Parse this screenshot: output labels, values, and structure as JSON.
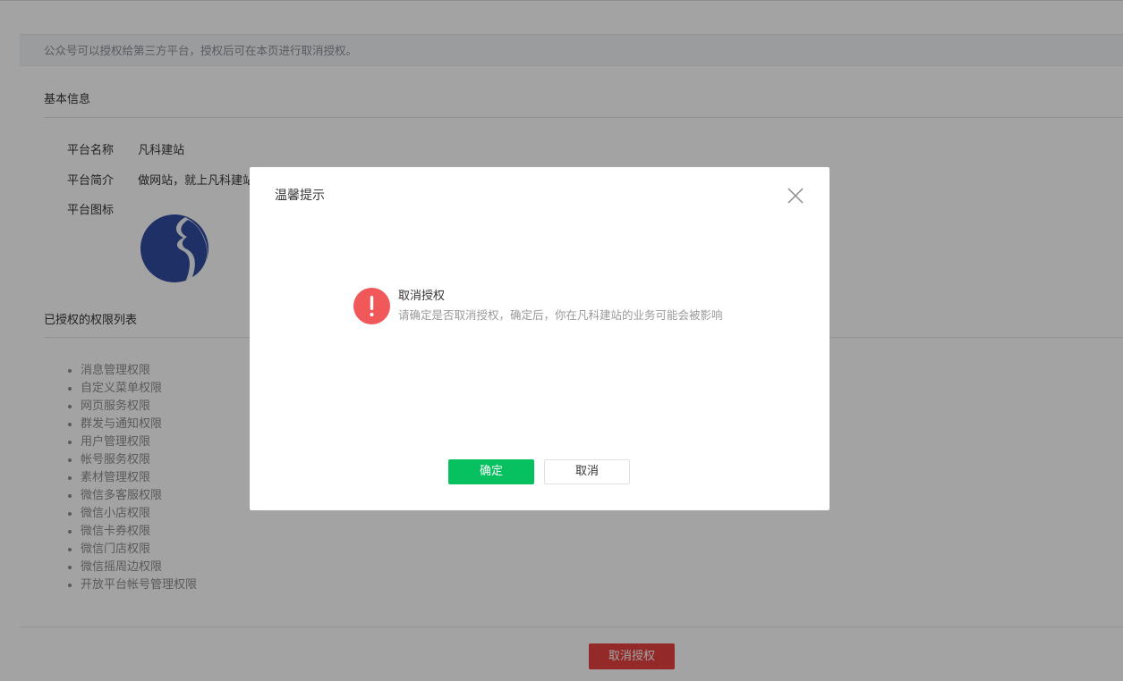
{
  "notice": {
    "text": "公众号可以授权给第三方平台，授权后可在本页进行取消授权。"
  },
  "basic_info": {
    "title": "基本信息",
    "rows": [
      {
        "label": "平台名称",
        "value": "凡科建站"
      },
      {
        "label": "平台简介",
        "value": "做网站，就上凡科建站"
      },
      {
        "label": "平台图标",
        "value": ""
      }
    ],
    "icon_colors": {
      "primary": "#2f4b9e",
      "secondary": "#ffffff"
    }
  },
  "permissions": {
    "title": "已授权的权限列表",
    "items": [
      "消息管理权限",
      "自定义菜单权限",
      "网页服务权限",
      "群发与通知权限",
      "用户管理权限",
      "帐号服务权限",
      "素材管理权限",
      "微信多客服权限",
      "微信小店权限",
      "微信卡券权限",
      "微信门店权限",
      "微信摇周边权限",
      "开放平台帐号管理权限"
    ]
  },
  "footer": {
    "revoke_label": "取消授权"
  },
  "dialog": {
    "title": "温馨提示",
    "close_icon": "close-icon",
    "message_icon": "warning-icon",
    "message_title": "取消授权",
    "message_desc": "请确定是否取消授权，确定后，你在凡科建站的业务可能会被影响",
    "confirm_label": "确定",
    "cancel_label": "取消"
  },
  "colors": {
    "accent_green": "#07c160",
    "danger_red": "#e64340",
    "warning_icon": "#f0585a"
  }
}
